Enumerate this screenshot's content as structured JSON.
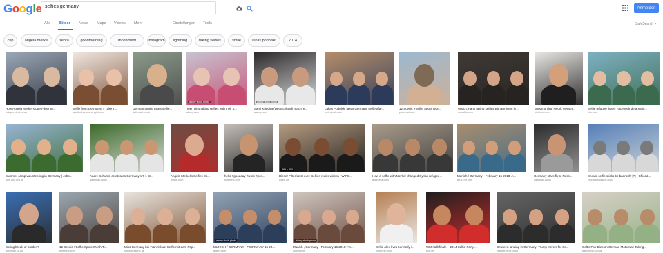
{
  "header": {
    "logo_letters": [
      "G",
      "o",
      "o",
      "g",
      "l",
      "e"
    ],
    "logo_colors": [
      "#4285f4",
      "#ea4335",
      "#fbbc05",
      "#4285f4",
      "#34a853",
      "#ea4335"
    ],
    "search_query": "selfies germany",
    "signin_label": "Anmelden",
    "accent_color": "#4285f4"
  },
  "tabs": {
    "items": [
      "Alle",
      "Bilder",
      "News",
      "Maps",
      "Videos",
      "Mehr",
      "Einstellungen",
      "Tools"
    ],
    "active_index": 1,
    "safesearch": "SafeSearch ▾"
  },
  "chips": [
    "cup",
    "angela merkel",
    "zebra",
    "goodmorning",
    "modament",
    "instagram",
    "lightning",
    "taking selfies",
    "smile",
    "lukas podolski",
    "2014"
  ],
  "results": [
    {
      "caption": "How Angela Merkel's open-door m...",
      "source": "independent.co.uk",
      "colors": [
        "#9aa7b7",
        "#d9b99f",
        "#30333b"
      ]
    },
    {
      "caption": "Selfie from Germany! = Take T...",
      "source": "takethefreeboundnglet.com",
      "colors": [
        "#efe6e0",
        "#e8c1a8",
        "#7a4e33"
      ]
    },
    {
      "caption": "German tourist takes selfie...",
      "source": "dailymail.co.uk",
      "colors": [
        "#8a9a8a",
        "#d8b08c",
        "#4a4a4a"
      ]
    },
    {
      "caption": "Teen girls taking selfies with their s...",
      "source": "alamy.com",
      "colors": [
        "#c7c2cf",
        "#e6c3b3",
        "#c74e72"
      ],
      "watermark": "alamy stock photo"
    },
    {
      "caption": "Sami Khedira (Deutschland) macht e...",
      "source": "alamy.com",
      "colors": [
        "#2d2a2b",
        "#c89a7e",
        "#e8e8e8"
      ],
      "watermark": "alamy stock photo"
    },
    {
      "caption": "Lukas Podolski takes Germany selfie afte...",
      "source": "metrocraft.com",
      "colors": [
        "#b48d6a",
        "#d6a88a",
        "#2c3b5a"
      ]
    },
    {
      "caption": "12 Scenic #Selfie Spots Wor...",
      "source": "pinterest.com",
      "colors": [
        "#9cb8d0",
        "#7f6a55",
        "#d1b094"
      ]
    },
    {
      "caption": "Watch: Fans taking selfies with Eminem in ...",
      "source": "newsfile.com",
      "colors": [
        "#403a35",
        "#d4a488",
        "#262321"
      ]
    },
    {
      "caption": "goodmorning #work #westn...",
      "source": "pinterest.com",
      "colors": [
        "#e8e6e2",
        "#d4a07c",
        "#1f1f1f"
      ]
    },
    {
      "caption": "Selfie refugee' loses Facebook defamatio...",
      "source": "bbc.com",
      "colors": [
        "#7db1c2",
        "#e2bda1",
        "#3c6a4e"
      ]
    },
    {
      "caption": "Summer camp volunteering in Germany | Jobs...",
      "source": "jobs.ahs.org.uk",
      "colors": [
        "#97b4d4",
        "#e3b08c",
        "#3b6b2f"
      ]
    },
    {
      "caption": "Andre Schurrle celebrates Germany's 7-1 Br...",
      "source": "dailymail.co.uk",
      "colors": [
        "#3d6a2a",
        "#c99872",
        "#e5e5e5"
      ]
    },
    {
      "caption": "Angela Merkel's Selfies Wi...",
      "source": "bustle.com",
      "colors": [
        "#6b4d43",
        "#dcaa8e",
        "#b52b2b"
      ]
    },
    {
      "caption": "hello #goodday #work #pos...",
      "source": "pinterest.com",
      "colors": [
        "#c4bdb7",
        "#c6946f",
        "#242424"
      ]
    },
    {
      "caption": "Dieser Filter lässt eure Selfies realer wirken | WIRE...",
      "source": "wired.de",
      "colors": [
        "#b49a80",
        "#7a4d33",
        "#1a1a1a"
      ],
      "watermark": "885 × 450"
    },
    {
      "caption": "How a selfie with Merkel changed Syrian refugee...",
      "source": "aljazeera.com",
      "colors": [
        "#a99b8a",
        "#b88867",
        "#383838"
      ]
    },
    {
      "caption": "Munich / Germany - February 15 2018: A...",
      "source": "de.123rf.com",
      "colors": [
        "#a98d6e",
        "#d29d79",
        "#3a6a8a"
      ]
    },
    {
      "caption": "Germany stars fly to Russ...",
      "source": "dailymail.co.uk",
      "colors": [
        "#2c2c2c",
        "#c99474",
        "#9a9a9a"
      ]
    },
    {
      "caption": "Should selfie sticks be banned? [?] - Chicad...",
      "source": "chicadeblogspot.com",
      "colors": [
        "#5580b8",
        "#7a7a7a",
        "#d8d8d8"
      ]
    },
    {
      "caption": "Spring break or burden?",
      "source": "dailymail.co.uk",
      "colors": [
        "#3a6fb5",
        "#d3a58a",
        "#2a2a2a"
      ]
    },
    {
      "caption": "12 Scenic #Selfie Spots Worth Ti...",
      "source": "pinterest.com",
      "colors": [
        "#9aa8b0",
        "#c99d84",
        "#4a3c36"
      ]
    },
    {
      "caption": "Miss Germany bei Franziskus: Selfie mit dem Pap...",
      "source": "sueddeutsche.de",
      "colors": [
        "#e8e4de",
        "#dcb094",
        "#7a4c2e"
      ]
    },
    {
      "caption": "MUNICH / GERMANY - FEBRUARY 15 20...",
      "source": "alamy.com",
      "colors": [
        "#93a3b5",
        "#c58e6b",
        "#2b3e5a"
      ],
      "watermark": "alamy stock photo"
    },
    {
      "caption": "Munich , Germany - February 15 2018: An...",
      "source": "alamy.com",
      "colors": [
        "#cfc6c0",
        "#d8a98e",
        "#6a4a3c"
      ],
      "watermark": "alamy stock photo"
    },
    {
      "caption": "Selfie Alex lives currently i...",
      "source": "pinterest.com",
      "colors": [
        "#b57f52",
        "#e0b49a",
        "#f0f0f0"
      ]
    },
    {
      "caption": "WM-Halbfinale – 2014 Selfie-Party ...",
      "source": "bild.de",
      "colors": [
        "#1f1f1f",
        "#c6865f",
        "#d22d2d"
      ]
    },
    {
      "caption": "Between landing in Germany: Trump travels for Se...",
      "source": "independent.co.uk",
      "colors": [
        "#656565",
        "#d4a283",
        "#2c2c2c"
      ]
    },
    {
      "caption": "Celtic Fan Dies on German Motorway Taking...",
      "source": "dailyrecord.co.uk",
      "colors": [
        "#d7d0c7",
        "#b88b69",
        "#93b184"
      ]
    }
  ]
}
